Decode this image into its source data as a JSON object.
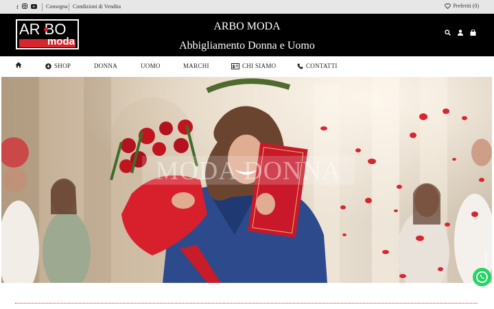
{
  "topbar": {
    "social": [
      "facebook-icon",
      "instagram-icon",
      "youtube-icon"
    ],
    "link_delivery": "Consegna",
    "link_terms": "Condizioni di Vendita",
    "favorites": "Preferiti (0)"
  },
  "header": {
    "logo_top": "AR BO",
    "logo_bottom": "moda",
    "title": "ARBO MODA",
    "subtitle": "Abbigliamento Donna e Uomo",
    "icons": [
      "search-icon",
      "user-icon",
      "cart-icon"
    ]
  },
  "nav": {
    "home_icon": "home-icon",
    "items": [
      {
        "label": "SHOP",
        "icon": "download-circle-icon"
      },
      {
        "label": "DONNA"
      },
      {
        "label": "UOMO"
      },
      {
        "label": "MARCHI"
      },
      {
        "label": "CHI SIAMO",
        "icon": "id-card-icon"
      },
      {
        "label": "CONTATTI",
        "icon": "phone-icon"
      }
    ]
  },
  "hero": {
    "overlay_text": "MODA DONNA"
  },
  "widgets": {
    "whatsapp": "whatsapp-icon",
    "badge": "protected"
  },
  "colors": {
    "accent": "#d7262e",
    "header_bg": "#000000",
    "topbar_bg": "#e7e7e7",
    "suit_blue": "#2c4a8c"
  }
}
